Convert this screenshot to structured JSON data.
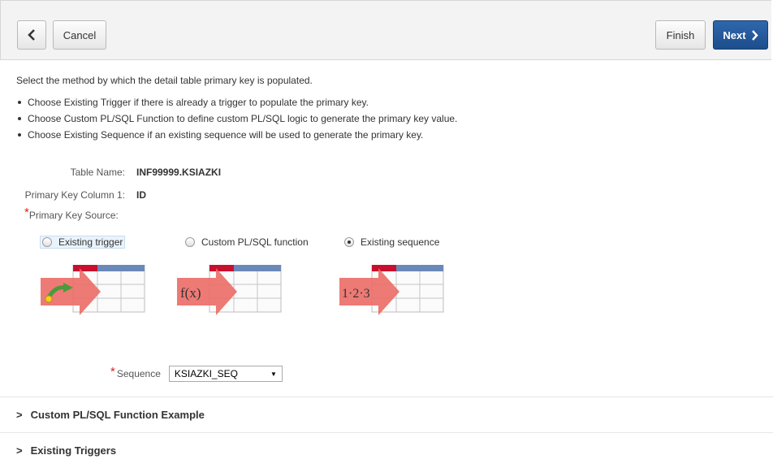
{
  "toolbar": {
    "back_icon": "chevron-left-icon",
    "cancel_label": "Cancel",
    "finish_label": "Finish",
    "next_label": "Next",
    "next_icon": "chevron-right-icon"
  },
  "intro": {
    "text": "Select the method by which the detail table primary key is populated.",
    "bullets": [
      "Choose Existing Trigger if there is already a trigger to populate the primary key.",
      "Choose Custom PL/SQL Function to define custom PL/SQL logic to generate the primary key value.",
      "Choose Existing Sequence if an existing sequence will be used to generate the primary key."
    ]
  },
  "fields": {
    "table_name_label": "Table Name:",
    "table_name_value": "INF99999.KSIAZKI",
    "pk_column_label": "Primary Key Column 1:",
    "pk_column_value": "ID",
    "pk_source_label": "Primary Key Source:",
    "required_mark": "*"
  },
  "pk_source_options": [
    {
      "label": "Existing trigger",
      "checked": false,
      "icon": "existing-trigger-illustration"
    },
    {
      "label": "Custom PL/SQL function",
      "checked": false,
      "icon": "custom-function-illustration",
      "glyph": "f(x)"
    },
    {
      "label": "Existing sequence",
      "checked": true,
      "icon": "existing-sequence-illustration",
      "glyph": "1·2·3"
    }
  ],
  "sequence": {
    "label": "Sequence",
    "value": "KSIAZKI_SEQ"
  },
  "regions": {
    "custom_function_title": "Custom PL/SQL Function Example",
    "existing_triggers_title": "Existing Triggers"
  },
  "colors": {
    "accent_blue": "#1d4d8c",
    "header_red": "#c8102e",
    "header_blue": "#6b89b8",
    "arrow_red": "#e8524f"
  }
}
